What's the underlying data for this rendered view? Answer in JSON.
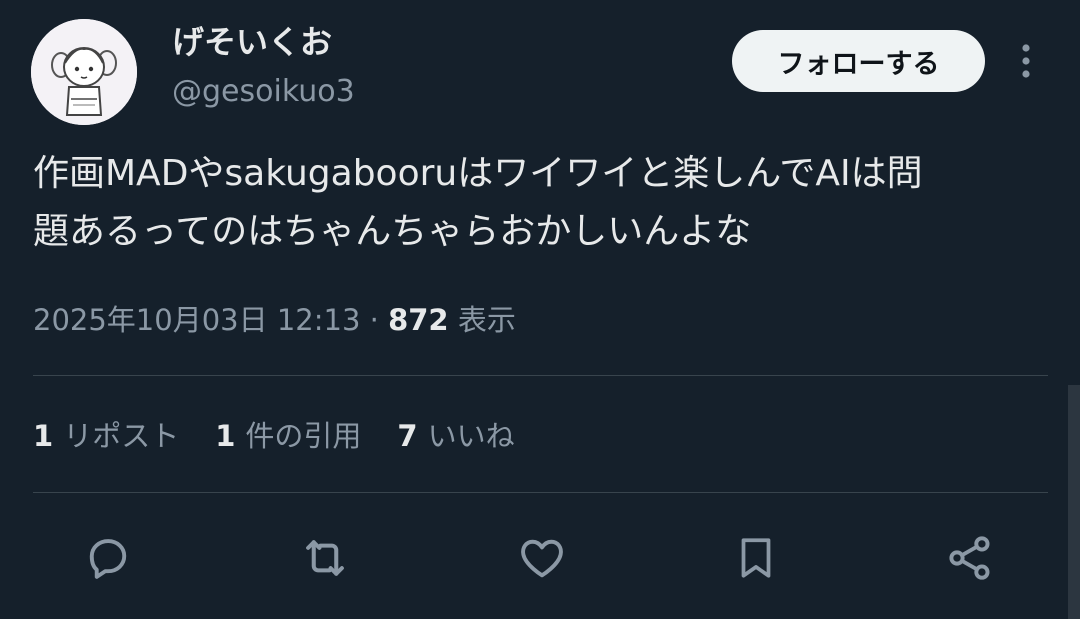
{
  "author": {
    "display_name": "げそいくお",
    "handle": "@gesoikuo3"
  },
  "follow_button": "フォローする",
  "tweet": {
    "text_line1": "作画MADやsakugabooruはワイワイと楽しんでAIは問",
    "text_line2": "題あるってのはちゃんちゃらおかしいんよな"
  },
  "meta": {
    "timestamp": "2025年10月03日 12:13",
    "separator": " · ",
    "views_count": "872",
    "views_label": " 表示"
  },
  "stats": {
    "reposts_count": "1",
    "reposts_label": "リポスト",
    "quotes_count": "1",
    "quotes_label": "件の引用",
    "likes_count": "7",
    "likes_label": "いいね"
  },
  "icons": {
    "more": "more-vertical-icon",
    "reply": "reply-icon",
    "retweet": "retweet-icon",
    "like": "heart-icon",
    "bookmark": "bookmark-icon",
    "share": "share-icon"
  },
  "colors": {
    "background": "#15202b",
    "text_primary": "#e7e9ea",
    "text_secondary": "#8b98a5",
    "divider": "#38444d",
    "button_bg": "#eff3f4"
  }
}
